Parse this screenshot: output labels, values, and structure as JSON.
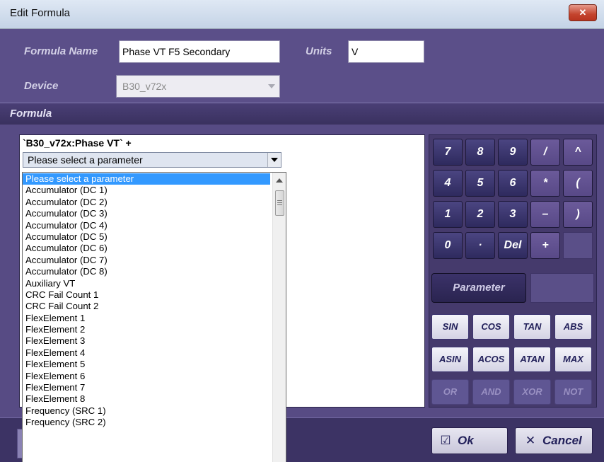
{
  "window": {
    "title": "Edit Formula",
    "close_label": "✕"
  },
  "form": {
    "formula_name_label": "Formula Name",
    "formula_name_value": "Phase VT F5 Secondary",
    "units_label": "Units",
    "units_value": "V",
    "device_label": "Device",
    "device_value": "B30_v72x"
  },
  "section": {
    "title": "Formula"
  },
  "editor": {
    "expression": "`B30_v72x:Phase VT` +",
    "combo_value": "Please select a parameter"
  },
  "parameter_list": [
    "Please select a parameter",
    "Accumulator (DC 1)",
    "Accumulator (DC 2)",
    "Accumulator (DC 3)",
    "Accumulator (DC 4)",
    "Accumulator (DC 5)",
    "Accumulator (DC 6)",
    "Accumulator (DC 7)",
    "Accumulator (DC 8)",
    "Auxiliary VT",
    "CRC Fail Count 1",
    "CRC Fail Count 2",
    "FlexElement 1",
    "FlexElement 2",
    "FlexElement 3",
    "FlexElement 4",
    "FlexElement 5",
    "FlexElement 6",
    "FlexElement 7",
    "FlexElement 8",
    "Frequency (SRC 1)",
    "Frequency (SRC 2)"
  ],
  "keypad": {
    "k7": "7",
    "k8": "8",
    "k9": "9",
    "kdiv": "/",
    "kpow": "^",
    "k4": "4",
    "k5": "5",
    "k6": "6",
    "kmul": "*",
    "klp": "(",
    "k1": "1",
    "k2": "2",
    "k3": "3",
    "kminus": "–",
    "krp": ")",
    "k0": "0",
    "kdot": "·",
    "kdel": "Del",
    "kplus": "+"
  },
  "parameter_button": "Parameter",
  "functions": {
    "sin": "SIN",
    "cos": "COS",
    "tan": "TAN",
    "abs": "ABS",
    "asin": "ASIN",
    "acos": "ACOS",
    "atan": "ATAN",
    "max": "MAX",
    "or": "OR",
    "and": "AND",
    "xor": "XOR",
    "not": "NOT"
  },
  "buttons": {
    "ok": "Ok",
    "cancel": "Cancel",
    "ok_icon": "checkbox-icon",
    "cancel_icon": "x-icon"
  }
}
